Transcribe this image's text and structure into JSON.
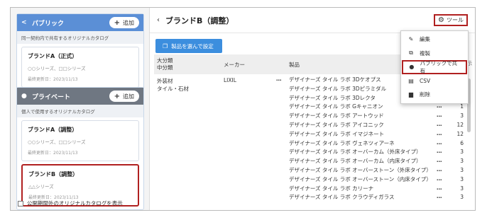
{
  "sidebar": {
    "public_panel": {
      "title": "パブリック",
      "add_label": "追加",
      "description": "同一契約内で共有するオリジナルカタログ",
      "cards": [
        {
          "title": "ブランドA（正式）",
          "series": "○○シリーズ、□□シリーズ",
          "updated": "最終更新日：2023/11/13"
        }
      ]
    },
    "private_panel": {
      "title": "プライベート",
      "add_label": "追加",
      "description": "個人で使用するオリジナルカタログ",
      "cards": [
        {
          "title": "ブランドA（調整）",
          "series": "○○シリーズ、□□シリーズ",
          "updated": "最終更新日：2023/11/13"
        },
        {
          "title": "ブランドB（調整）",
          "series": "△△シリーズ",
          "updated": "最終更新日：2023/11/13"
        }
      ]
    },
    "show_expired_label": "公開期間外のオリジナルカタログを表示"
  },
  "header": {
    "back": "‹",
    "title": "ブランドB（調整）",
    "tool_label": "ツール"
  },
  "select_button": "製品を選んで設定",
  "display_label": "示",
  "table": {
    "headers": {
      "category": "大分類\n中分類",
      "maker": "メーカー",
      "product": "製品"
    },
    "group": {
      "category_main": "外装材",
      "category_sub": "タイル・石材",
      "maker": "LIXIL",
      "dots": "…"
    },
    "products": [
      {
        "name": "デザイナーズ タイル ラボ 3Dケオプス",
        "count": "3"
      },
      {
        "name": "デザイナーズ タイル ラボ 3Dピラミダル",
        "count": "3"
      },
      {
        "name": "デザイナーズ タイル ラボ 3Dレクタ",
        "count": "3"
      },
      {
        "name": "デザイナーズ タイル ラボ Gキャニオン",
        "count": "1"
      },
      {
        "name": "デザイナーズ タイル ラボ アートウッド",
        "count": "3"
      },
      {
        "name": "デザイナーズ タイル ラボ アイコニック",
        "count": "12"
      },
      {
        "name": "デザイナーズ タイル ラボ イマジネート",
        "count": "12"
      },
      {
        "name": "デザイナーズ タイル ラボ ヴェネツィアーネ",
        "count": "6"
      },
      {
        "name": "デザイナーズ タイル ラボ オーバーカム（外床タイプ）",
        "count": "3"
      },
      {
        "name": "デザイナーズ タイル ラボ オーバーカム（内床タイプ）",
        "count": "3"
      },
      {
        "name": "デザイナーズ タイル ラボ オーバーストーン（外床タイプ）",
        "count": "3"
      },
      {
        "name": "デザイナーズ タイル ラボ オーバーストーン（内床タイプ）",
        "count": "3"
      },
      {
        "name": "デザイナーズ タイル ラボ カリーナ",
        "count": "3"
      },
      {
        "name": "デザイナーズ タイル ラボ クラウディガラス",
        "count": "3"
      }
    ]
  },
  "menu": {
    "items": [
      {
        "icon": "edit-icon",
        "label": "編集"
      },
      {
        "icon": "copy-icon",
        "label": "複製"
      },
      {
        "icon": "share-group-icon",
        "label": "パブリックで共有"
      },
      {
        "icon": "csv-file-icon",
        "label": "CSV"
      },
      {
        "icon": "trash-icon",
        "label": "削除"
      }
    ]
  },
  "colors": {
    "accent": "#3c8ede",
    "highlight": "#b02020",
    "public_header": "#5b8fd6",
    "private_header": "#6f7782"
  }
}
